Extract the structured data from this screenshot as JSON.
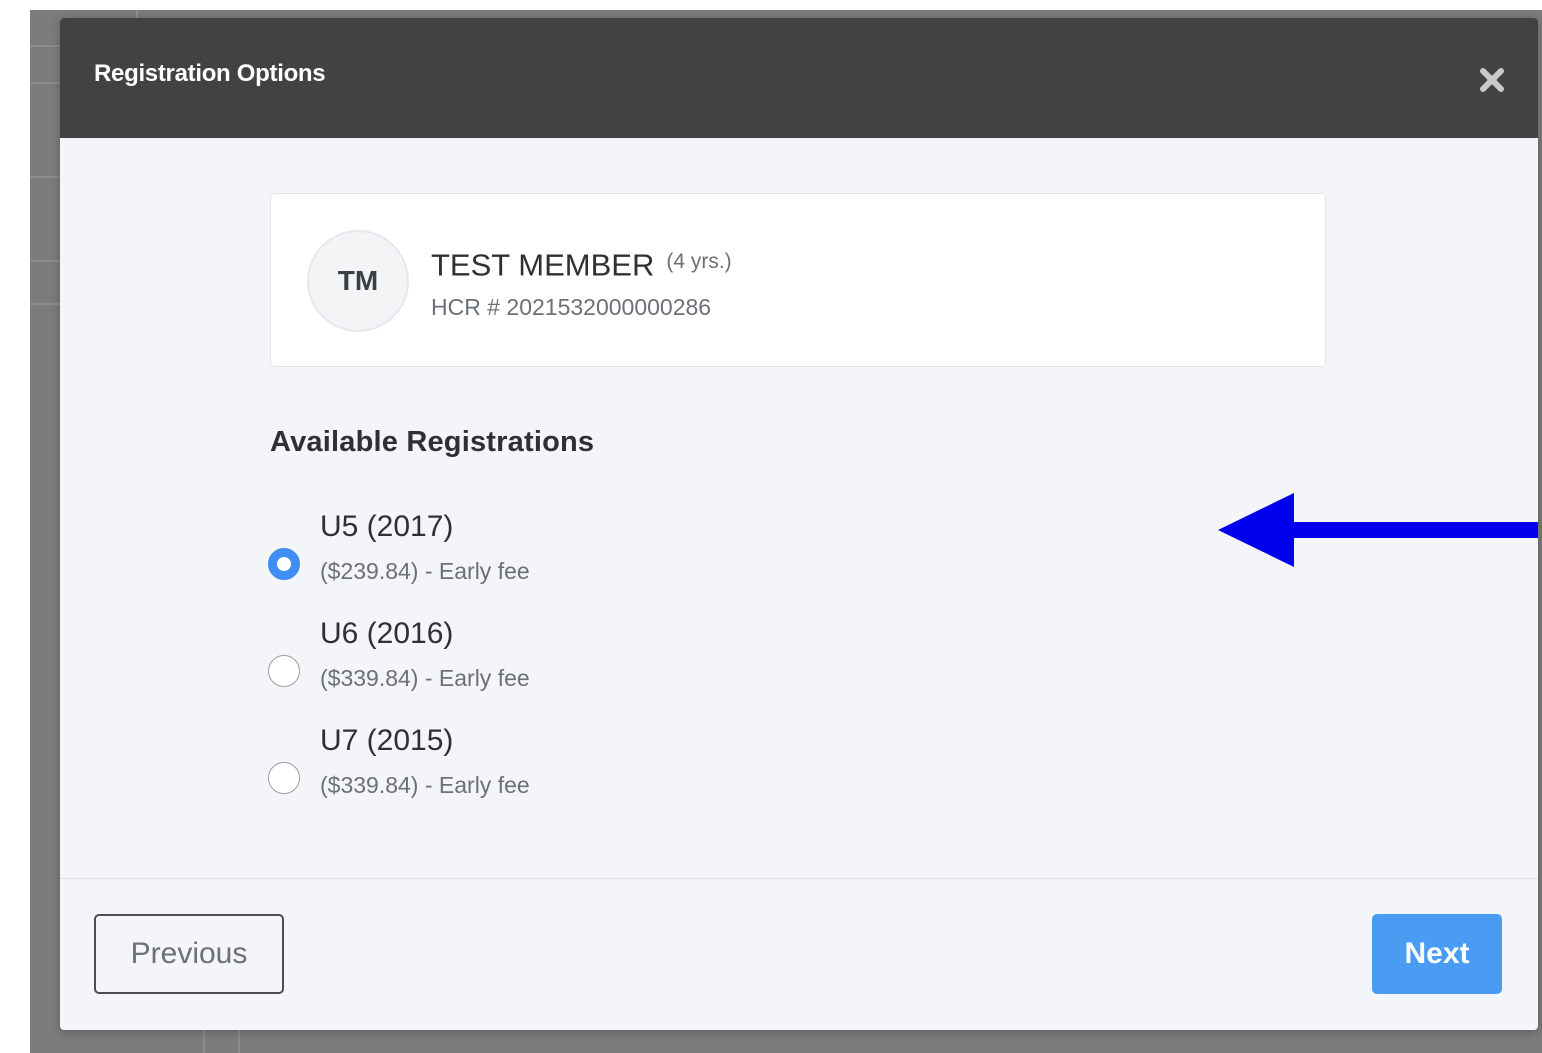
{
  "modal": {
    "title": "Registration Options",
    "close_icon": "close-icon"
  },
  "member": {
    "initials": "TM",
    "name": "TEST MEMBER",
    "age": "(4 yrs.)",
    "hcr": "HCR # 2021532000000286"
  },
  "registrations": {
    "title": "Available Registrations",
    "options": [
      {
        "label": "U5 (2017)",
        "fee": "($239.84) - Early fee",
        "selected": true
      },
      {
        "label": "U6 (2016)",
        "fee": "($339.84) - Early fee",
        "selected": false
      },
      {
        "label": "U7 (2015)",
        "fee": "($339.84) - Early fee",
        "selected": false
      }
    ]
  },
  "footer": {
    "previous_label": "Previous",
    "next_label": "Next"
  },
  "colors": {
    "header_bg": "#424242",
    "accent": "#4a9bf2",
    "radio_selected": "#3f8ef2",
    "annotation_arrow": "#0000ee"
  }
}
